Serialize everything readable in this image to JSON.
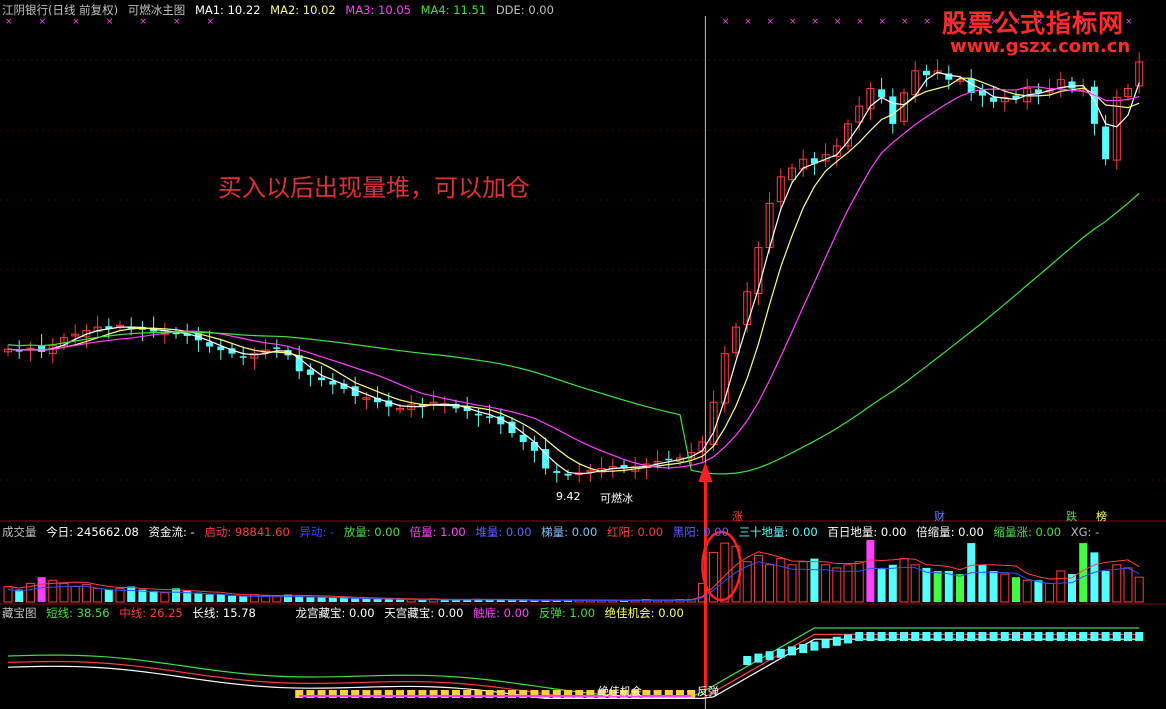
{
  "main_header": {
    "stock": "江阴银行(日线 前复权)",
    "indicator": "可燃冰主图",
    "ma1": "MA1: 10.22",
    "ma2": "MA2: 10.02",
    "ma3": "MA3: 10.05",
    "ma4": "MA4: 11.51",
    "dde": "DDE: 0.00"
  },
  "watermark": {
    "line1": "股票公式指标网",
    "line2": "www.gszx.com.cn"
  },
  "annotation": "买入以后出现量堆，可以加仓",
  "low_label": "9.42",
  "kerosene_label": "可燃冰",
  "event_tags": [
    "涨",
    "财",
    "跌",
    "榜"
  ],
  "volume_header": {
    "name": "成交量",
    "today": "今日: 245662.08",
    "fund": "资金流: -",
    "qidong": "启动: 98841.60",
    "yidong": "异动: -",
    "fangliang": "放量: 0.00",
    "beiliang": "倍量: 1.00",
    "duiliang": "堆量: 0.00",
    "tiliang": "梯量: 0.00",
    "hongyang": "红阳: 0.00",
    "heiyang": "黑阳: 0.00",
    "dishiliang": "三十地量: 0.00",
    "bairi": "百日地量: 0.00",
    "beisuo": "倍缩量: 0.00",
    "suozhang": "缩量涨: 0.00",
    "xg": "XG: -"
  },
  "bottom_header": {
    "name": "藏宝图",
    "short": "短线: 38.56",
    "mid": "中线: 26.25",
    "long": "长线: 15.78",
    "longgong": "龙宫藏宝: 0.00",
    "tiangong": "天宫藏宝: 0.00",
    "chudi": "触底: 0.00",
    "fantan": "反弹: 1.00",
    "jiajia": "绝佳机会: 0.00"
  },
  "bottom_labels": {
    "jiajia_text": "绝佳机会",
    "fantan_text": "反弹"
  },
  "colors": {
    "up": "#ff3b3b",
    "down": "#54ffff",
    "ma_short": "#ffffff",
    "ma_mid": "#ffff80",
    "ma_long": "#ff40ff",
    "ma_vlong": "#40e040",
    "arrow": "#ff2020",
    "panel_border": "#7a1010"
  },
  "chart_data": [
    {
      "type": "candlestick",
      "title": "江阴银行(日线 前复权) 可燃冰主图",
      "price_range": [
        9.3,
        14.2
      ],
      "series": [
        {
          "name": "MA1",
          "value": 10.22
        },
        {
          "name": "MA2",
          "value": 10.02
        },
        {
          "name": "MA3",
          "value": 10.05
        },
        {
          "name": "MA4",
          "value": 11.51
        }
      ],
      "closes": [
        10.95,
        10.93,
        10.96,
        10.92,
        10.99,
        11.08,
        11.12,
        11.16,
        11.2,
        11.18,
        11.22,
        11.2,
        11.17,
        11.15,
        11.16,
        11.12,
        11.1,
        11.05,
        10.98,
        10.94,
        10.9,
        10.86,
        10.9,
        10.94,
        10.96,
        10.88,
        10.7,
        10.66,
        10.6,
        10.55,
        10.5,
        10.42,
        10.4,
        10.35,
        10.3,
        10.28,
        10.32,
        10.3,
        10.35,
        10.33,
        10.28,
        10.25,
        10.2,
        10.18,
        10.1,
        10.0,
        9.9,
        9.8,
        9.6,
        9.55,
        9.52,
        9.55,
        9.58,
        9.6,
        9.62,
        9.6,
        9.62,
        9.65,
        9.68,
        9.7,
        9.72,
        9.78,
        9.9,
        10.35,
        10.9,
        11.2,
        11.6,
        12.1,
        12.6,
        12.9,
        13.0,
        13.1,
        13.05,
        13.15,
        13.25,
        13.5,
        13.7,
        13.9,
        13.8,
        13.5,
        13.85,
        14.1,
        14.05,
        14.1,
        14.0,
        14.0,
        13.85,
        13.82,
        13.75,
        13.8,
        13.78,
        13.9,
        13.85,
        13.88,
        14.0,
        13.9,
        13.9,
        13.5,
        13.1,
        13.8,
        13.9,
        14.2
      ]
    },
    {
      "type": "bar",
      "title": "成交量",
      "values_rel": [
        0.25,
        0.2,
        0.3,
        0.4,
        0.35,
        0.3,
        0.25,
        0.28,
        0.22,
        0.2,
        0.22,
        0.25,
        0.2,
        0.18,
        0.15,
        0.22,
        0.18,
        0.15,
        0.12,
        0.12,
        0.1,
        0.1,
        0.12,
        0.1,
        0.1,
        0.12,
        0.1,
        0.09,
        0.08,
        0.07,
        0.08,
        0.06,
        0.06,
        0.05,
        0.05,
        0.05,
        0.04,
        0.04,
        0.05,
        0.04,
        0.04,
        0.04,
        0.05,
        0.04,
        0.04,
        0.03,
        0.03,
        0.03,
        0.04,
        0.03,
        0.03,
        0.03,
        0.03,
        0.03,
        0.03,
        0.03,
        0.03,
        0.04,
        0.03,
        0.03,
        0.04,
        0.04,
        0.3,
        0.8,
        0.95,
        0.9,
        0.65,
        0.75,
        0.6,
        0.7,
        0.6,
        0.65,
        0.7,
        0.6,
        0.55,
        0.6,
        0.65,
        1.0,
        0.55,
        0.6,
        0.7,
        0.6,
        0.55,
        0.5,
        0.5,
        0.45,
        0.95,
        0.6,
        0.5,
        0.45,
        0.4,
        0.35,
        0.35,
        0.3,
        0.5,
        0.45,
        0.95,
        0.8,
        0.5,
        0.6,
        0.55,
        0.4
      ]
    },
    {
      "type": "line",
      "title": "藏宝图",
      "series": [
        {
          "name": "短线",
          "value": 38.56
        },
        {
          "name": "中线",
          "value": 26.25
        },
        {
          "name": "长线",
          "value": 15.78
        }
      ]
    }
  ]
}
